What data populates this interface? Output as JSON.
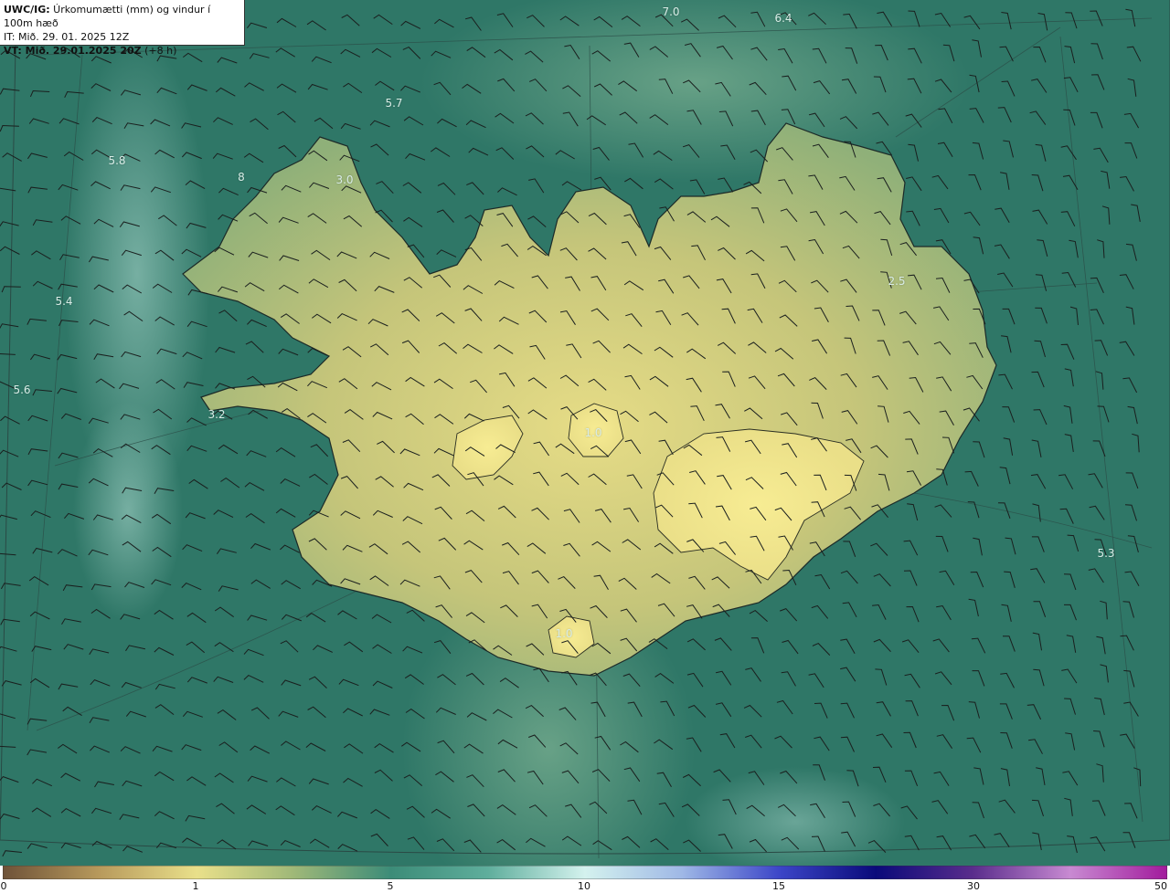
{
  "header": {
    "line1_bold": "UWC/IG:",
    "line1_rest": " Úrkomumætti (mm) og vindur í 100m hæð",
    "line2": "IT: Mið. 29. 01. 2025 12Z",
    "line3_bold": "VT: Mið. 29.01.2025 20Z",
    "line3_rest": " (+8 h)"
  },
  "map_labels": [
    {
      "text": "7.0"
    },
    {
      "text": "6.4"
    },
    {
      "text": "5.7"
    },
    {
      "text": "5.8"
    },
    {
      "text": "8"
    },
    {
      "text": "3.0"
    },
    {
      "text": "5.4"
    },
    {
      "text": "5.6"
    },
    {
      "text": "3.2"
    },
    {
      "text": "2.5"
    },
    {
      "text": "1.0"
    },
    {
      "text": "5.3"
    },
    {
      "text": "1.0"
    }
  ],
  "colorbar": {
    "ticks": [
      "0",
      "1",
      "5",
      "10",
      "15",
      "30",
      "50"
    ],
    "colors": [
      "#6e5238",
      "#b89a5c",
      "#e9e08a",
      "#9fb878",
      "#3c8c78",
      "#5fae9c",
      "#d4f2ee",
      "#9fb8e6",
      "#3c46c8",
      "#0a0a7a",
      "#5a2d8c",
      "#c88ad2",
      "#a21a9c"
    ]
  }
}
